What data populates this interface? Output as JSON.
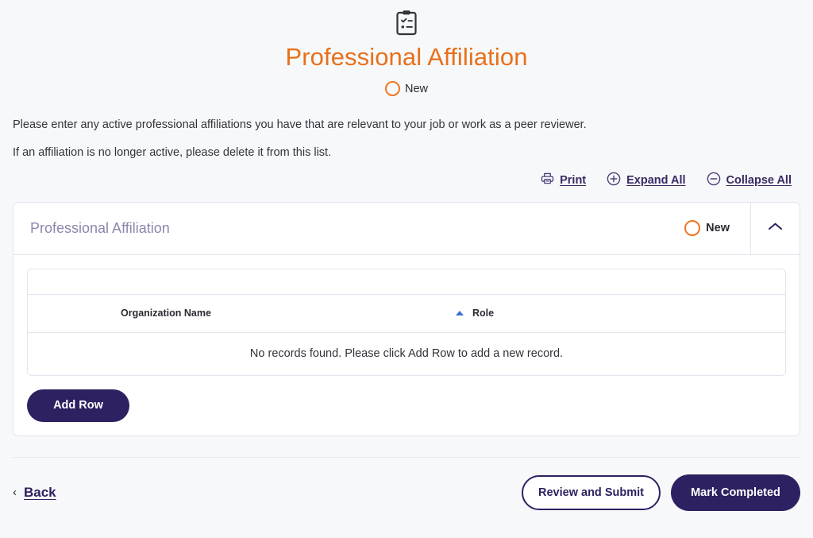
{
  "page": {
    "icon": "clipboard-checklist-icon",
    "title": "Professional Affiliation",
    "status": "New",
    "accent_orange": "#e8701a",
    "accent_navy": "#2e2161"
  },
  "instructions": [
    "Please enter any active professional affiliations you have that are relevant to your job or work as a peer reviewer.",
    "If an affiliation is no longer active, please delete it from this list."
  ],
  "toolbar": {
    "print": "Print",
    "expand_all": "Expand All",
    "collapse_all": "Collapse All"
  },
  "section": {
    "title": "Professional Affiliation",
    "status": "New",
    "toggle_state": "expanded"
  },
  "table": {
    "columns": [
      {
        "label": "Organization Name",
        "sorted": false
      },
      {
        "label": "Role",
        "sorted": true,
        "sort_direction": "ascending"
      }
    ],
    "rows": [],
    "empty_message": "No records found. Please click Add Row to add a new record."
  },
  "actions": {
    "add_row": "Add Row",
    "back": "Back",
    "review_and_submit": "Review and Submit",
    "mark_completed": "Mark Completed"
  }
}
